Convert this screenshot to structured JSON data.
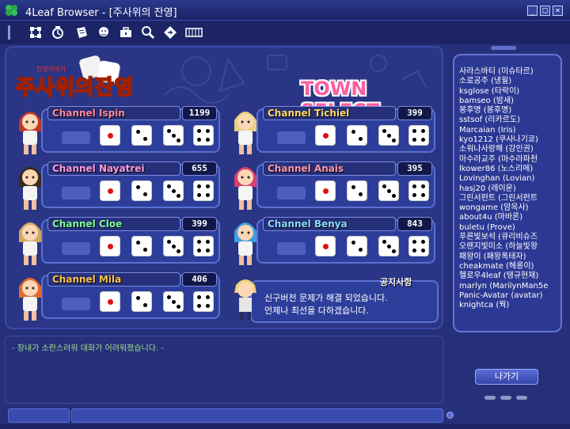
{
  "window": {
    "title": "4Leaf Browser - [주사위의 잔영]",
    "buttons": {
      "minimize": "_",
      "maximize": "□",
      "close": "×"
    }
  },
  "toolbar": {
    "icons": [
      "network-icon",
      "alarm-icon",
      "notebook-icon",
      "character-icon",
      "briefcase-icon",
      "search-icon",
      "diamond-nav-icon",
      "film-icon"
    ]
  },
  "logo": {
    "text": "주사위의잔영",
    "subtitle": "잔영이야기"
  },
  "town_title": "TOWN SELECT",
  "channels": [
    {
      "name": "Channel Ispin",
      "count": "1199",
      "color": "#ff8aa0",
      "hair": "#c0392b"
    },
    {
      "name": "Channel Tichiel",
      "count": "399",
      "color": "#ffd86a",
      "hair": "#e8d080"
    },
    {
      "name": "Channel Nayatrei",
      "count": "655",
      "color": "#ff9ae0",
      "hair": "#3a2a18"
    },
    {
      "name": "Channel Anais",
      "count": "395",
      "color": "#ff9ab0",
      "hair": "#d84070"
    },
    {
      "name": "Channel Cloe",
      "count": "399",
      "color": "#7dff9a",
      "hair": "#d4a860"
    },
    {
      "name": "Channel Benya",
      "count": "843",
      "color": "#8ad8ff",
      "hair": "#3f9de0"
    },
    {
      "name": "Channel Mila",
      "count": "406",
      "color": "#ffc24a",
      "hair": "#e06a30"
    }
  ],
  "notice": {
    "title": "공지사항",
    "lines": [
      "신구버전 문제가 해결 되었습니다.",
      "언제나 최선을 다하겠습니다."
    ]
  },
  "chat": {
    "message": "- 장내가 소란스러워 대화가 어려워졌습니다. -"
  },
  "users": [
    "사라스바티 (미슈타르)",
    "소로공주 (냉월)",
    "ksglose (타락이)",
    "bamseo (밤새)",
    "봉후명 (봉후명)",
    "sstsof (리카르도)",
    "Marcaian (Iris)",
    "kyo1212 (쿠사나기쿄)",
    "소워나사랑해 (강인권)",
    "마수라교주 (마수라파천",
    "lkower86 (노스리메)",
    "Lovinghan (Lovian)",
    "hasj20 (레이운)",
    "그린서펀트 (그린서펀트",
    "wongame (암옥사)",
    "about4u (마바론)",
    "buletu (Prove)",
    "푸른빛보석 (큐리비슈즈",
    "오렌지빛미소 (하늘빛왕",
    "패왕이 (패왕폭태자)",
    "cheakmate (헤롱이)",
    "헬로우4leaf (탱규현재)",
    "marlyn (MarilynMan5e",
    "Panic-Avatar (avatar)",
    "knightca (뭑)"
  ],
  "exit_button": "나가기",
  "colors": {
    "background": "#26307a",
    "panel": "#2d3e9a",
    "accent": "#ff5ea0"
  }
}
